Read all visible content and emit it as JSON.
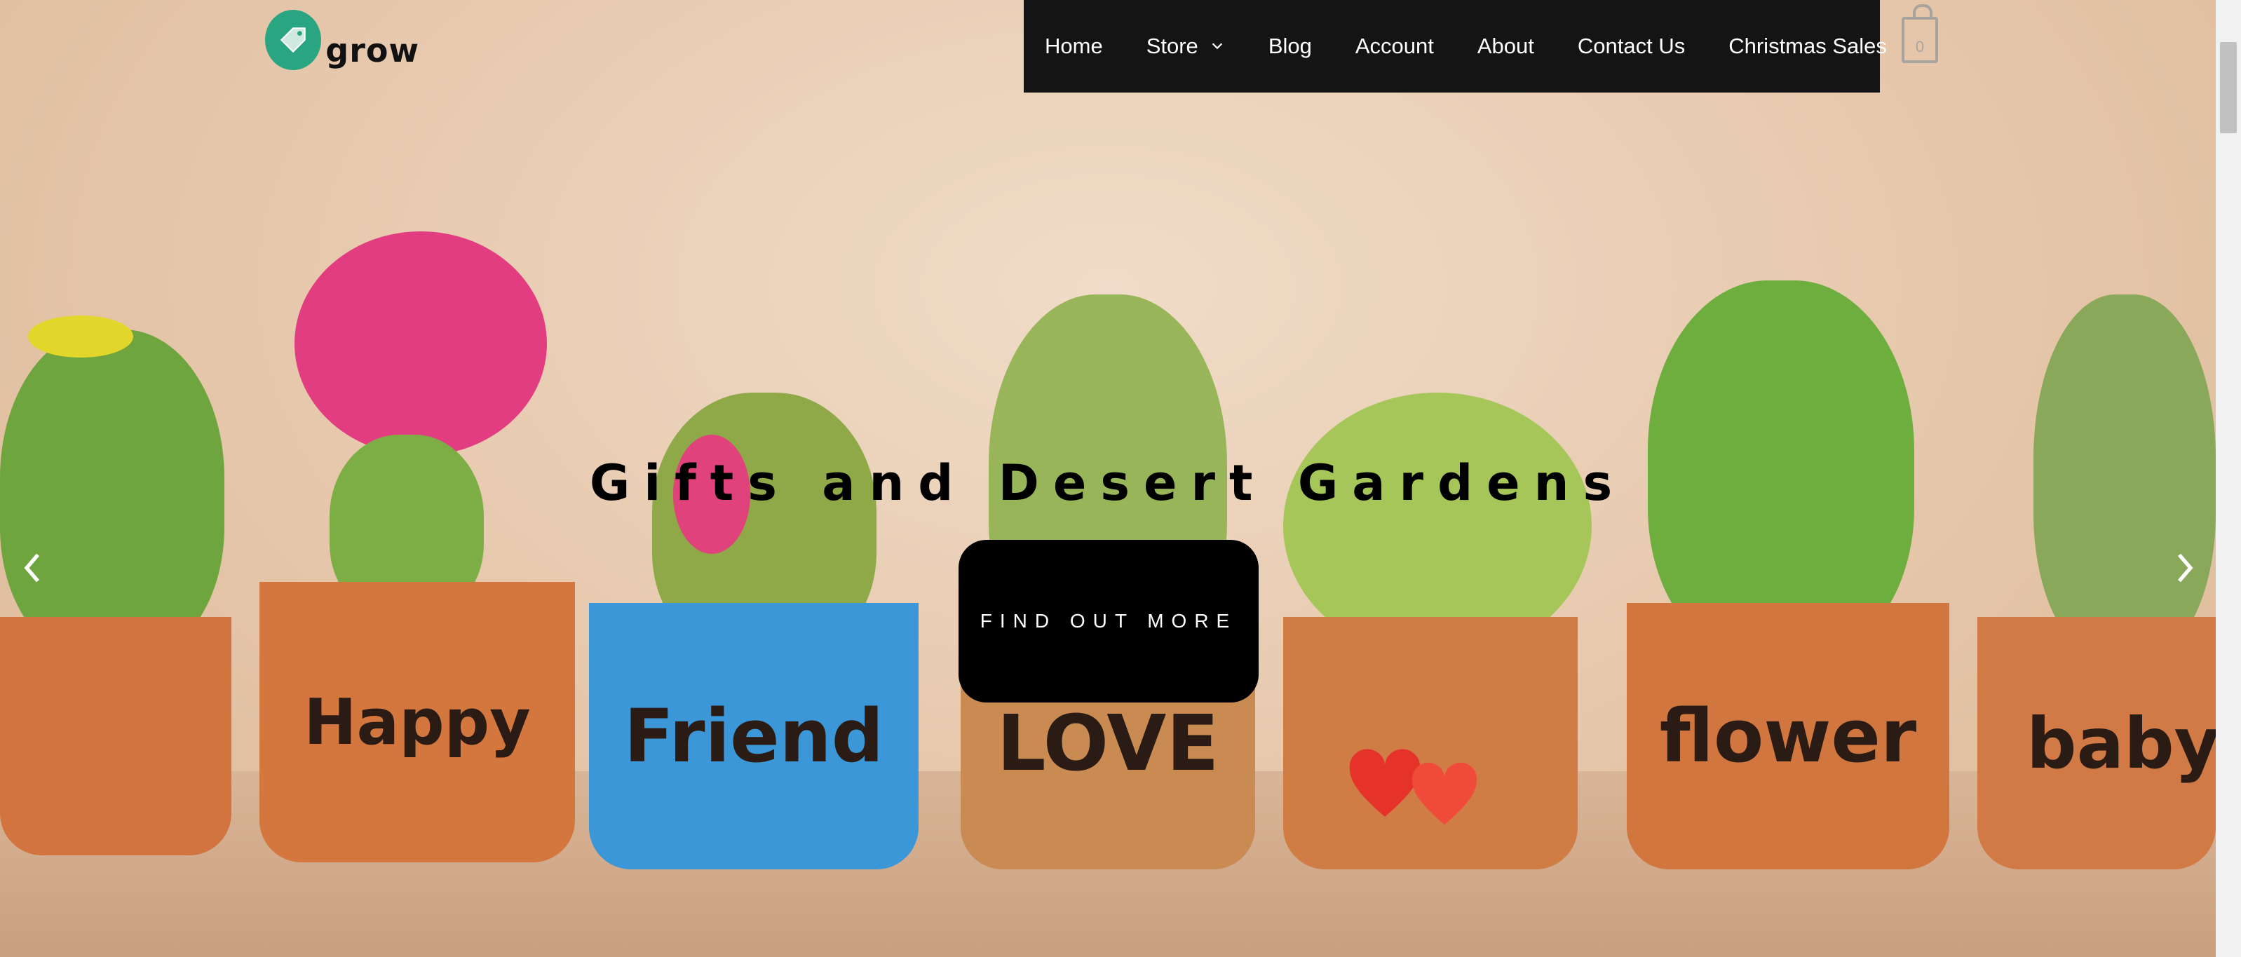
{
  "brand": {
    "name": "grow"
  },
  "nav": {
    "items": [
      {
        "label": "Home"
      },
      {
        "label": "Store",
        "has_dropdown": true
      },
      {
        "label": "Blog"
      },
      {
        "label": "Account"
      },
      {
        "label": "About"
      },
      {
        "label": "Contact Us"
      },
      {
        "label": "Christmas Sales"
      }
    ],
    "cart_count": "0"
  },
  "hero": {
    "title": "Gifts and Desert Gardens",
    "cta_label": "FIND OUT MORE",
    "pot_labels": [
      "Happy",
      "Friend",
      "LOVE",
      "flower",
      "baby"
    ]
  },
  "colors": {
    "nav_bg": "#141414",
    "logo_accent": "#2aa581",
    "cta_bg": "#000000"
  },
  "icons": [
    "tag-icon",
    "chevron-down-icon",
    "cart-icon",
    "chevron-left-icon",
    "chevron-right-icon"
  ]
}
